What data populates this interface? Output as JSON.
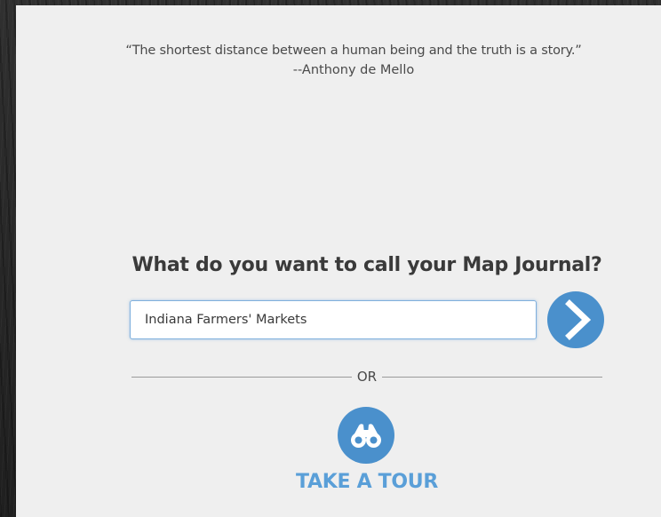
{
  "quote": {
    "text": "“The shortest distance between a human being and the truth is a story.”",
    "author": "--Anthony de Mello"
  },
  "form": {
    "question": "What do you want to call your Map Journal?",
    "title_value": "Indiana Farmers' Markets",
    "submit_icon": "chevron-right-icon"
  },
  "divider": {
    "label": "OR"
  },
  "tour": {
    "icon": "binoculars-icon",
    "label": "TAKE A TOUR"
  },
  "colors": {
    "accent": "#4a90cc",
    "link": "#5a9fd8",
    "panel_background": "#efefef",
    "page_background": "#2a2a2a"
  }
}
